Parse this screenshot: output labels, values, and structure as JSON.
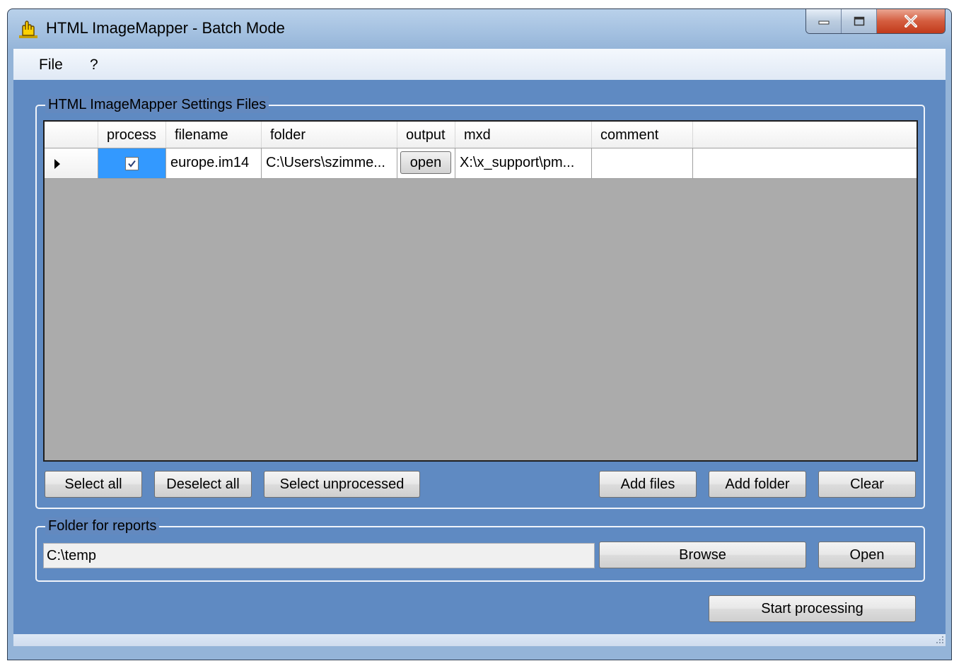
{
  "window": {
    "title": "HTML ImageMapper - Batch Mode"
  },
  "menu": {
    "file": "File",
    "help": "?"
  },
  "settings_group": {
    "label": "HTML ImageMapper Settings Files",
    "columns": [
      "process",
      "filename",
      "folder",
      "output",
      "mxd",
      "comment"
    ],
    "rows": [
      {
        "process_checked": true,
        "filename": "europe.im14",
        "folder": "C:\\Users\\szimme...",
        "output_button": "open",
        "mxd": "X:\\x_support\\pm...",
        "comment": ""
      }
    ],
    "buttons": {
      "select_all": "Select all",
      "deselect_all": "Deselect all",
      "select_unprocessed": "Select unprocessed",
      "add_files": "Add files",
      "add_folder": "Add folder",
      "clear": "Clear"
    }
  },
  "reports_group": {
    "label": "Folder for reports",
    "folder_value": "C:\\temp",
    "browse": "Browse",
    "open": "Open"
  },
  "start_processing": "Start processing",
  "icons": {
    "app": "hand-pointer-icon",
    "minimize": "minimize-icon",
    "maximize": "maximize-icon",
    "close": "close-icon"
  },
  "colors": {
    "client_background": "#5f8ac2",
    "selected_cell": "#3399ff",
    "grid_empty": "#ababab"
  }
}
